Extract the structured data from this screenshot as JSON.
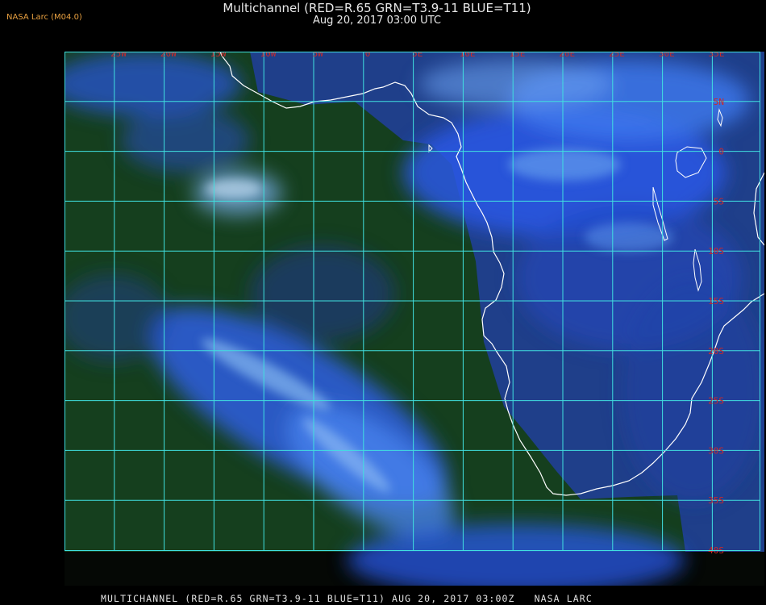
{
  "header": {
    "producer": "NASA Larc (M04.0)",
    "title": "Multichannel (RED=R.65 GRN=T3.9-11 BLUE=T11)",
    "subtitle": "Aug 20, 2017 03:00 UTC"
  },
  "map": {
    "longitude_labels": [
      "25W",
      "20W",
      "15W",
      "10W",
      "5W",
      "0",
      "5E",
      "10E",
      "15E",
      "20E",
      "25E",
      "30E",
      "35E"
    ],
    "latitude_labels": [
      "5N",
      "0",
      "5S",
      "10S",
      "15S",
      "20S",
      "25S",
      "30S",
      "35S",
      "40S"
    ],
    "grid_color": "#40e0e0",
    "label_color": "#cc2a2a",
    "coastline_color": "#ffffff",
    "ocean_color": "#15431f",
    "cloud_color": "#2f5ff0"
  },
  "footer": {
    "text": "MULTICHANNEL (RED=R.65 GRN=T3.9-11 BLUE=T11) AUG 20, 2017 03:00Z   NASA LARC"
  }
}
